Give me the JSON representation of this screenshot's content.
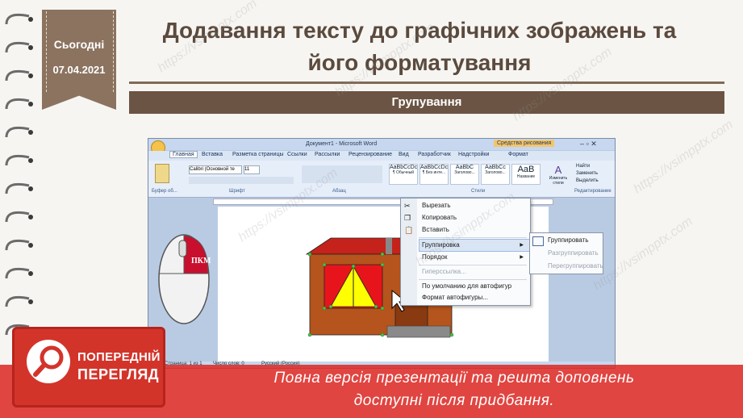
{
  "date": {
    "label": "Сьогодні",
    "value": "07.04.2021"
  },
  "title": {
    "line1": "Додавання тексту до графічних зображень та",
    "line2": "його форматування"
  },
  "section": "Групування",
  "word": {
    "window_title": "Документ1 - Microsoft Word",
    "tools_title": "Средства рисования",
    "tabs": [
      "Главная",
      "Вставка",
      "Разметка страницы",
      "Ссылки",
      "Рассылки",
      "Рецензирование",
      "Вид",
      "Разработчик",
      "Надстройки",
      "Формат"
    ],
    "font": "Calibri (Основной те",
    "font_size": "11",
    "groups": [
      "Буфер об...",
      "Шрифт",
      "Абзац",
      "Стили",
      "Редактирование"
    ],
    "styles": [
      {
        "preview": "AaBbCcDc",
        "name": "¶ Обычный"
      },
      {
        "preview": "AaBbCcDc",
        "name": "¶ Без инте..."
      },
      {
        "preview": "AaBbC",
        "name": "Заголово..."
      },
      {
        "preview": "AaBbCc",
        "name": "Заголово..."
      },
      {
        "preview": "AaB",
        "name": "Название"
      }
    ],
    "change_styles": "Изменить стили",
    "editing": [
      "Найти",
      "Заменить",
      "Выделить"
    ],
    "status": [
      "Страница: 1 из 1",
      "Число слов: 0",
      "Русский (Россия)"
    ]
  },
  "context_menu": {
    "items": [
      {
        "label": "Вырезать",
        "disabled": false
      },
      {
        "label": "Копировать",
        "disabled": false
      },
      {
        "label": "Вставить",
        "disabled": false
      },
      {
        "label": "Группировка",
        "disabled": false,
        "submenu": true
      },
      {
        "label": "Порядок",
        "disabled": false,
        "submenu": true
      },
      {
        "label": "Гиперссылка...",
        "disabled": true
      },
      {
        "label": "По умолчанию для автофигур",
        "disabled": false
      },
      {
        "label": "Формат автофигуры...",
        "disabled": false
      }
    ]
  },
  "submenu": {
    "items": [
      {
        "label": "Группировать",
        "disabled": false
      },
      {
        "label": "Разгруппировать",
        "disabled": true
      },
      {
        "label": "Перегруппировать",
        "disabled": true
      }
    ]
  },
  "mouse_label": "ПКМ",
  "preview_badge": {
    "line1": "ПОПЕРЕДНІЙ",
    "line2": "ПЕРЕГЛЯД"
  },
  "banner": {
    "line1": "Повна версія презентації та решта доповнень",
    "line2": "доступні після придбання."
  },
  "watermark": "https://vsimpptx.com",
  "colors": {
    "brown": "#6b5444",
    "red": "#d3342a",
    "roof": "#c5221b",
    "wall": "#b5541c",
    "yellow": "#ffff00"
  }
}
